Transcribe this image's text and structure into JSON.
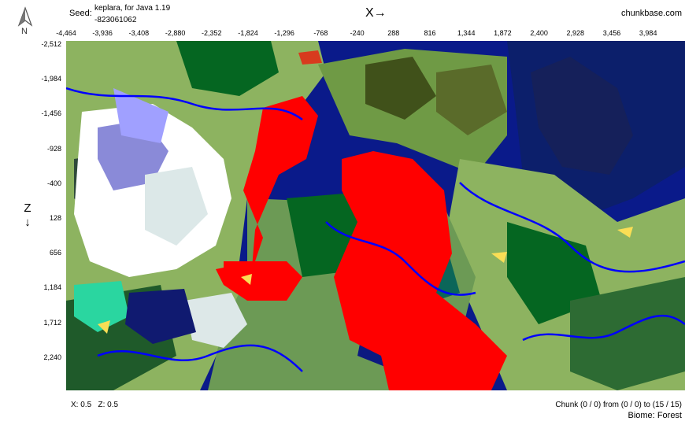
{
  "header": {
    "seed_label": "Seed:",
    "seed_title": "keplara, for Java 1.19",
    "seed_value": "-823061062",
    "x_axis_label": "X→",
    "site": "chunkbase.com"
  },
  "compass": {
    "icon": "north-arrow-icon",
    "letter": "N"
  },
  "z_axis_label": "Z↓",
  "x_ticks": [
    "-4,464",
    "-3,936",
    "-3,408",
    "-2,880",
    "-2,352",
    "-1,824",
    "-1,296",
    "-768",
    "-240",
    "288",
    "816",
    "1,344",
    "1,872",
    "2,400",
    "2,928",
    "3,456",
    "3,984"
  ],
  "z_ticks": [
    "-2,512",
    "-1,984",
    "-1,456",
    "-928",
    "-400",
    "128",
    "656",
    "1,184",
    "1,712",
    "2,240"
  ],
  "footer": {
    "coords_x_label": "X:",
    "coords_x": "0.5",
    "coords_z_label": "Z:",
    "coords_z": "0.5",
    "chunk_text": "Chunk (0 / 0) from (0 / 0) to (15 / 15)",
    "biome_label": "Biome:",
    "biome_value": "Forest"
  },
  "colors": {
    "ocean": "#0a1a8a",
    "deep_ocean": "#0c1f6b",
    "plains": "#8db360",
    "forest": "#056621",
    "dark_forest": "#40511a",
    "taiga": "#0b6659",
    "snowy": "#ffffff",
    "ice": "#a0a0ff",
    "badlands": "#ff0000",
    "river": "#0000ff",
    "beach": "#fade55"
  }
}
